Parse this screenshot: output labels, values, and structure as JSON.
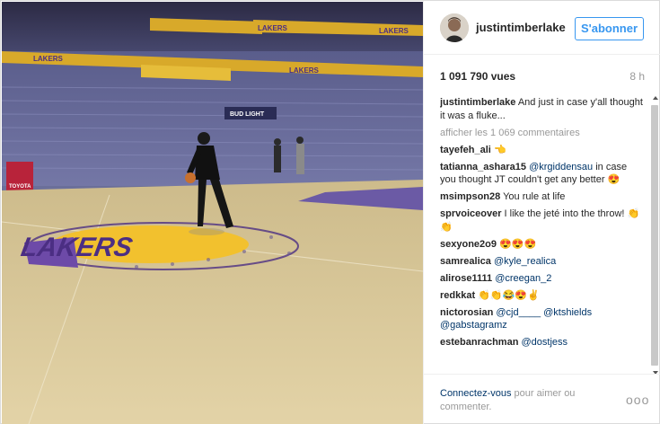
{
  "post": {
    "username": "justintimberlake",
    "follow_label": "S'abonner",
    "views": "1 091 790 vues",
    "time_ago": "8 h"
  },
  "media": {
    "court_logo": "LAKERS",
    "banner_texts": [
      "LAKERS",
      "LAKERS",
      "LAKERS",
      "LAKERS",
      "LAKERS"
    ],
    "sponsor_left": "TOYOTA",
    "sponsor_center": "BUD LIGHT",
    "colors": {
      "arena": "#5b5e86",
      "floor": "#d9c89a",
      "gold": "#f2c12e",
      "purple": "#4b2e83"
    }
  },
  "caption": {
    "username": "justintimberlake",
    "text": "And just in case y'all thought it was a fluke..."
  },
  "load_more": "afficher les 1 069 commentaires",
  "comments": [
    {
      "user": "tayefeh_ali",
      "text": "👈",
      "mentions": []
    },
    {
      "user": "tatianna_ashara15",
      "mention": "@krgiddensau",
      "text": " in case you thought JT couldn't get any better 😍"
    },
    {
      "user": "msimpson28",
      "text": "You rule at life"
    },
    {
      "user": "sprvoiceover",
      "text": "I like the jeté into the throw! 👏👏"
    },
    {
      "user": "sexyone2o9",
      "text": "😍😍😍"
    },
    {
      "user": "samrealica",
      "mention": "@kyle_realica",
      "text": ""
    },
    {
      "user": "alirose1111",
      "mention": "@creegan_2",
      "text": ""
    },
    {
      "user": "redkkat",
      "text": "👏👏😂😍✌"
    },
    {
      "user": "nictorosian",
      "mention": "@cjd____",
      "text": " @ktshields @gabstagramz"
    },
    {
      "user": "estebanrachman",
      "mention": "@dostjess",
      "text": ""
    },
    {
      "user": "",
      "text": ""
    }
  ],
  "footer": {
    "login_link": "Connectez-vous",
    "login_rest": " pour aimer ou commenter.",
    "more_label": "ooo"
  }
}
